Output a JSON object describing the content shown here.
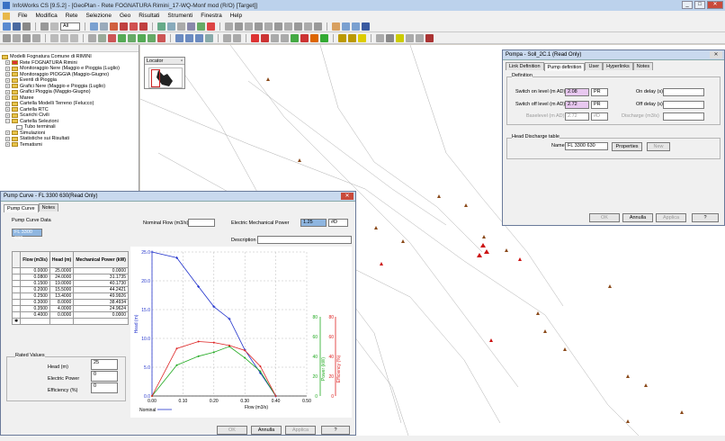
{
  "app": {
    "title": "InfoWorks CS [9.5.2] - [GeoPlan - Rete FOGNATURA Rimini_17-WQ-Monf mod (R/O) [Target]]"
  },
  "menu": [
    "File",
    "Modifica",
    "Rete",
    "Selezione",
    "Geo",
    "Risultati",
    "Strumenti",
    "Finestra",
    "Help"
  ],
  "toolbar": {
    "combo": "All"
  },
  "tree": {
    "items": [
      {
        "label": "Modelli Fognatura Comune di RIMINI",
        "level": 0
      },
      {
        "label": "Rete FOGNATURA Rimini",
        "level": 1
      },
      {
        "label": "Monitoraggio Nere (Maggio e Pioggia (Luglio)",
        "level": 1
      },
      {
        "label": "Monitoraggio PIOGGIA (Maggio-Giugno)",
        "level": 1
      },
      {
        "label": "Eventi di Pioggia",
        "level": 1
      },
      {
        "label": "Grafici Nere (Maggio e Pioggia (Luglio)",
        "level": 1
      },
      {
        "label": "Grafici Pioggia (Maggio-Giugno)",
        "level": 1
      },
      {
        "label": "Maree",
        "level": 1
      },
      {
        "label": "Cartella Modelli Terreno (Felucco)",
        "level": 1
      },
      {
        "label": "Cartella RTC",
        "level": 1
      },
      {
        "label": "Scarichi Civili",
        "level": 1
      },
      {
        "label": "Cartella Selezioni",
        "level": 1
      },
      {
        "label": "Tubo terminali",
        "level": 2
      },
      {
        "label": "Simulazioni",
        "level": 1
      },
      {
        "label": "Statistiche sui Risultati",
        "level": 1
      },
      {
        "label": "Tematismi",
        "level": 1
      }
    ]
  },
  "locator": {
    "title": "Locator"
  },
  "pump_dialog": {
    "title": "Pompa - Soll_2C.1 (Read Only)",
    "tabs": [
      "Link Definition",
      "Pump definition",
      "User",
      "Hyperlinks",
      "Notes"
    ],
    "definition_group": "Definition",
    "switch_on_label": "Switch on level (m AD)",
    "switch_on_value": "2.08",
    "switch_on_flag": "PR",
    "switch_off_label": "Switch off level (m AD)",
    "switch_off_value": "2.72",
    "switch_off_flag": "PR",
    "baselevel_label": "Baselevel (m AD)",
    "baselevel_value": "2.72",
    "baselevel_flag": "#D",
    "on_delay_label": "On delay (s)",
    "off_delay_label": "Off delay (s)",
    "discharge_label": "Discharge (m3/s)",
    "head_group": "Head Discharge table",
    "name_label": "Name",
    "name_value": "FL 3300 630",
    "properties_button": "Properties",
    "new_button": "New",
    "ok": "OK",
    "annulla": "Annulla",
    "applica": "Applica",
    "help": "?"
  },
  "curve_dialog": {
    "title": "Pump Curve - FL 3300 630(Read Only)",
    "tabs": [
      "Pump Curve",
      "Notes"
    ],
    "data_label": "Pump Curve Data",
    "curve_name": "FL 3300 630",
    "nominal_flow_label": "Nominal Flow (m3/s)",
    "nominal_flow_value": "",
    "power_label": "Electric Mechanical Power",
    "power_value": "1.25",
    "power_flag": "#D",
    "description_label": "Description",
    "description_value": "",
    "table_headers": [
      "Flow (m3/s)",
      "Head (m)",
      "Mechanical Power (kW)"
    ],
    "table_rows": [
      [
        "0.0000",
        "25.0000",
        "0.0000"
      ],
      [
        "0.0800",
        "24.0000",
        "31.1735"
      ],
      [
        "0.1500",
        "19.0000",
        "40.1730"
      ],
      [
        "0.2000",
        "15.5000",
        "44.2421"
      ],
      [
        "0.2500",
        "13.4000",
        "49.9926"
      ],
      [
        "0.3000",
        "8.0000",
        "38.4934"
      ],
      [
        "0.3500",
        "4.0000",
        "24.9624"
      ],
      [
        "0.4000",
        "0.0000",
        "0.0000"
      ]
    ],
    "rated_group": "Rated Values",
    "head_label": "Head (m)",
    "head_value": "25",
    "power_rated_label": "Electric Power",
    "power_rated_value": "0",
    "eff_label": "Efficiency (%)",
    "eff_value": "0",
    "ok": "OK",
    "annulla": "Annulla",
    "applica": "Applica",
    "help": "?"
  },
  "chart_data": {
    "type": "line",
    "x": [
      0,
      0.08,
      0.15,
      0.2,
      0.25,
      0.3,
      0.35,
      0.4
    ],
    "x_ticks": [
      "0.00",
      "0.10",
      "0.20",
      "0.30",
      "0.40",
      "0.50"
    ],
    "xlabel": "Flow (m3/s)",
    "xlim": [
      0,
      0.5
    ],
    "y_ticks": [
      "0.0",
      "5.0",
      "10.0",
      "15.0",
      "20.0",
      "25.0"
    ],
    "ylabel": "Head (m)",
    "ylim": [
      0,
      25
    ],
    "y2_ticks": [
      "0",
      "20",
      "40",
      "60",
      "80"
    ],
    "y2label": "Power (kW)",
    "y3_ticks": [
      "0",
      "20",
      "40",
      "60",
      "80"
    ],
    "y3label": "Efficiency (%)",
    "legend": "Nominal",
    "series": [
      {
        "name": "Nominal",
        "axis": "head",
        "color": "#2233cc",
        "values": [
          25,
          24,
          19,
          15.5,
          13.4,
          8,
          4,
          0
        ]
      },
      {
        "axis": "power",
        "color": "#22aa22",
        "values": [
          0,
          31.17,
          40.17,
          44.24,
          49.99,
          38.49,
          24.96,
          0
        ]
      },
      {
        "axis": "eff",
        "color": "#dd2222",
        "values": [
          0,
          48,
          55,
          54,
          51,
          46,
          30,
          0
        ]
      }
    ]
  }
}
